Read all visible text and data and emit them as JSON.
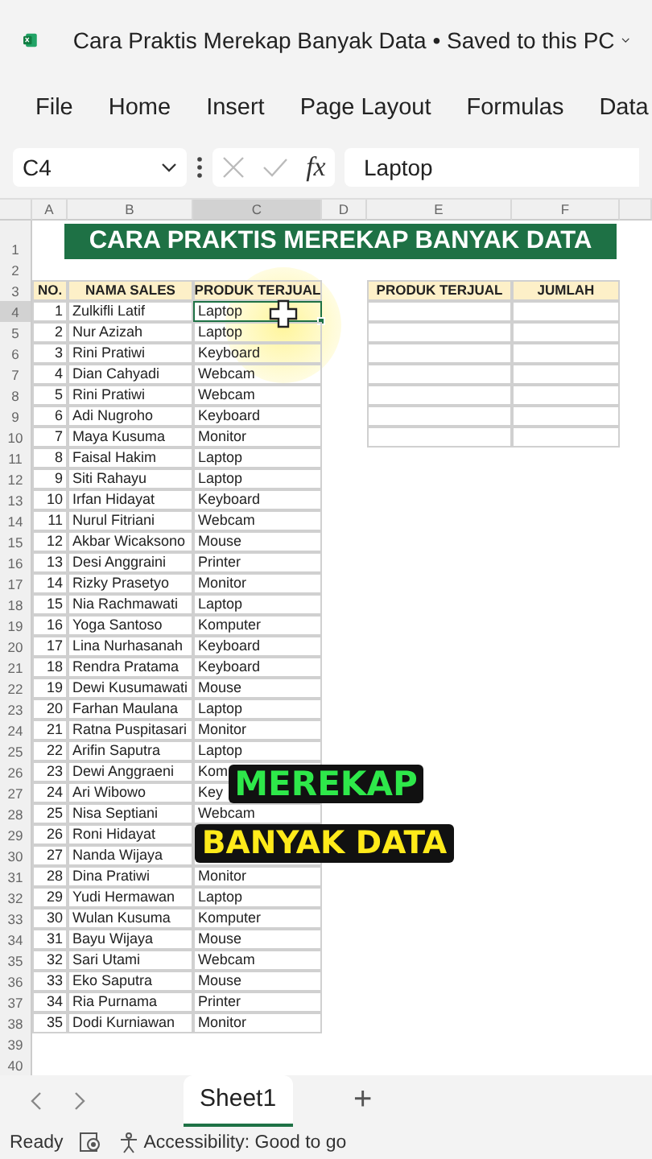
{
  "app": {
    "title": "Cara Praktis Merekap Banyak Data • Saved to this PC"
  },
  "ribbon_tabs": [
    "File",
    "Home",
    "Insert",
    "Page Layout",
    "Formulas",
    "Data"
  ],
  "formula_bar": {
    "name_box": "C4",
    "fx": "fx",
    "value": "Laptop"
  },
  "columns": [
    {
      "label": "A",
      "selected": false
    },
    {
      "label": "B",
      "selected": false
    },
    {
      "label": "C",
      "selected": true
    },
    {
      "label": "D",
      "selected": false
    },
    {
      "label": "E",
      "selected": false
    },
    {
      "label": "F",
      "selected": false
    }
  ],
  "row_headers": [
    "1",
    "2",
    "3",
    "4",
    "5",
    "6",
    "7",
    "8",
    "9",
    "10",
    "11",
    "12",
    "13",
    "14",
    "15",
    "16",
    "17",
    "18",
    "19",
    "20",
    "21",
    "22",
    "23",
    "24",
    "25",
    "26",
    "27",
    "28",
    "29",
    "30",
    "31",
    "32",
    "33",
    "34",
    "35",
    "36",
    "37",
    "38",
    "39",
    "40"
  ],
  "banner": "CARA PRAKTIS MEREKAP BANYAK DATA",
  "main_table": {
    "headers": [
      "NO.",
      "NAMA SALES",
      "PRODUK TERJUAL"
    ],
    "rows": [
      {
        "no": "1",
        "name": "Zulkifli Latif",
        "product": "Laptop",
        "selected": true
      },
      {
        "no": "2",
        "name": "Nur Azizah",
        "product": "Laptop",
        "selected": false
      },
      {
        "no": "3",
        "name": "Rini Pratiwi",
        "product": "Keyboard",
        "selected": false
      },
      {
        "no": "4",
        "name": "Dian Cahyadi",
        "product": "Webcam",
        "selected": false
      },
      {
        "no": "5",
        "name": "Rini Pratiwi",
        "product": "Webcam",
        "selected": false
      },
      {
        "no": "6",
        "name": "Adi Nugroho",
        "product": "Keyboard",
        "selected": false
      },
      {
        "no": "7",
        "name": "Maya Kusuma",
        "product": "Monitor",
        "selected": false
      },
      {
        "no": "8",
        "name": "Faisal Hakim",
        "product": "Laptop",
        "selected": false
      },
      {
        "no": "9",
        "name": "Siti Rahayu",
        "product": "Laptop",
        "selected": false
      },
      {
        "no": "10",
        "name": "Irfan Hidayat",
        "product": "Keyboard",
        "selected": false
      },
      {
        "no": "11",
        "name": "Nurul Fitriani",
        "product": "Webcam",
        "selected": false
      },
      {
        "no": "12",
        "name": "Akbar Wicaksono",
        "product": "Mouse",
        "selected": false
      },
      {
        "no": "13",
        "name": "Desi Anggraini",
        "product": "Printer",
        "selected": false
      },
      {
        "no": "14",
        "name": "Rizky Prasetyo",
        "product": "Monitor",
        "selected": false
      },
      {
        "no": "15",
        "name": "Nia Rachmawati",
        "product": "Laptop",
        "selected": false
      },
      {
        "no": "16",
        "name": "Yoga Santoso",
        "product": "Komputer",
        "selected": false
      },
      {
        "no": "17",
        "name": "Lina Nurhasanah",
        "product": "Keyboard",
        "selected": false
      },
      {
        "no": "18",
        "name": "Rendra Pratama",
        "product": "Keyboard",
        "selected": false
      },
      {
        "no": "19",
        "name": "Dewi Kusumawati",
        "product": "Mouse",
        "selected": false
      },
      {
        "no": "20",
        "name": "Farhan Maulana",
        "product": "Laptop",
        "selected": false
      },
      {
        "no": "21",
        "name": "Ratna Puspitasari",
        "product": "Monitor",
        "selected": false
      },
      {
        "no": "22",
        "name": "Arifin Saputra",
        "product": "Laptop",
        "selected": false
      },
      {
        "no": "23",
        "name": "Dewi Anggraeni",
        "product": "Kom",
        "selected": false
      },
      {
        "no": "24",
        "name": "Ari Wibowo",
        "product": "Key",
        "selected": false
      },
      {
        "no": "25",
        "name": "Nisa Septiani",
        "product": "Webcam",
        "selected": false
      },
      {
        "no": "26",
        "name": "Roni Hidayat",
        "selected": false
      },
      {
        "no": "27",
        "name": "Nanda Wijaya",
        "selected": false
      },
      {
        "no": "28",
        "name": "Dina Pratiwi",
        "product": "Monitor",
        "selected": false
      },
      {
        "no": "29",
        "name": "Yudi Hermawan",
        "product": "Laptop",
        "selected": false
      },
      {
        "no": "30",
        "name": "Wulan Kusuma",
        "product": "Komputer",
        "selected": false
      },
      {
        "no": "31",
        "name": "Bayu Wijaya",
        "product": "Mouse",
        "selected": false
      },
      {
        "no": "32",
        "name": "Sari Utami",
        "product": "Webcam",
        "selected": false
      },
      {
        "no": "33",
        "name": "Eko Saputra",
        "product": "Mouse",
        "selected": false
      },
      {
        "no": "34",
        "name": "Ria Purnama",
        "product": "Printer",
        "selected": false
      },
      {
        "no": "35",
        "name": "Dodi Kurniawan",
        "product": "Monitor",
        "selected": false
      }
    ]
  },
  "summary_table": {
    "headers": [
      "PRODUK TERJUAL",
      "JUMLAH"
    ]
  },
  "caption": [
    "MEREKAP",
    "BANYAK DATA"
  ],
  "sheet_tabs": [
    {
      "label": "Sheet1",
      "selected": true
    }
  ],
  "add_sheet": "+",
  "status_bar": {
    "state": "Ready",
    "accessibility": "Accessibility: Good to go"
  }
}
